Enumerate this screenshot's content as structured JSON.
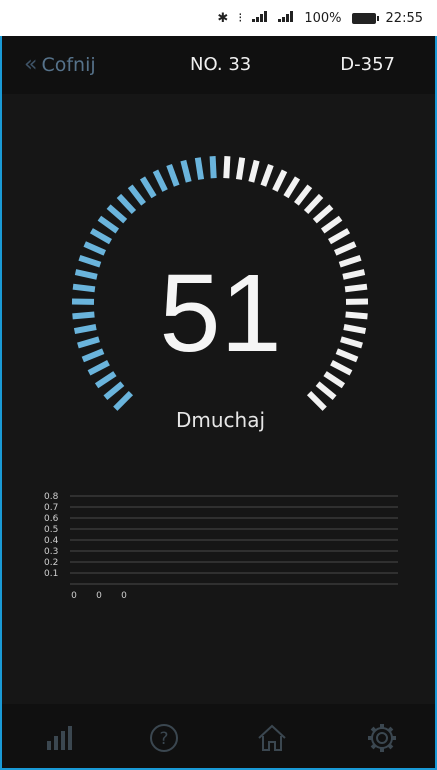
{
  "status_bar": {
    "battery": "100%",
    "time": "22:55",
    "icons": [
      "bluetooth-icon",
      "nfc-icon",
      "signal-icon",
      "signal-icon",
      "battery-icon"
    ]
  },
  "header": {
    "back_label": "Cofnij",
    "number": "NO. 33",
    "code": "D-357"
  },
  "gauge": {
    "value": "51",
    "label": "Dmuchaj",
    "progress": 0.51,
    "active_color": "#6ab4dc",
    "inactive_color": "#f2f2f2"
  },
  "chart_data": {
    "type": "bar",
    "y_ticks": [
      "0.8",
      "0.7",
      "0.6",
      "0.5",
      "0.4",
      "0.3",
      "0.2",
      "0.1"
    ],
    "x_labels": [
      "0",
      "0",
      "0"
    ],
    "values": [
      0,
      0,
      0
    ],
    "ylim": [
      0,
      0.8
    ],
    "grid": true
  },
  "bottom_nav": {
    "items": [
      "stats-icon",
      "help-icon",
      "home-icon",
      "settings-icon"
    ]
  },
  "colors": {
    "accent": "#1a9ad6",
    "background": "#161616"
  }
}
